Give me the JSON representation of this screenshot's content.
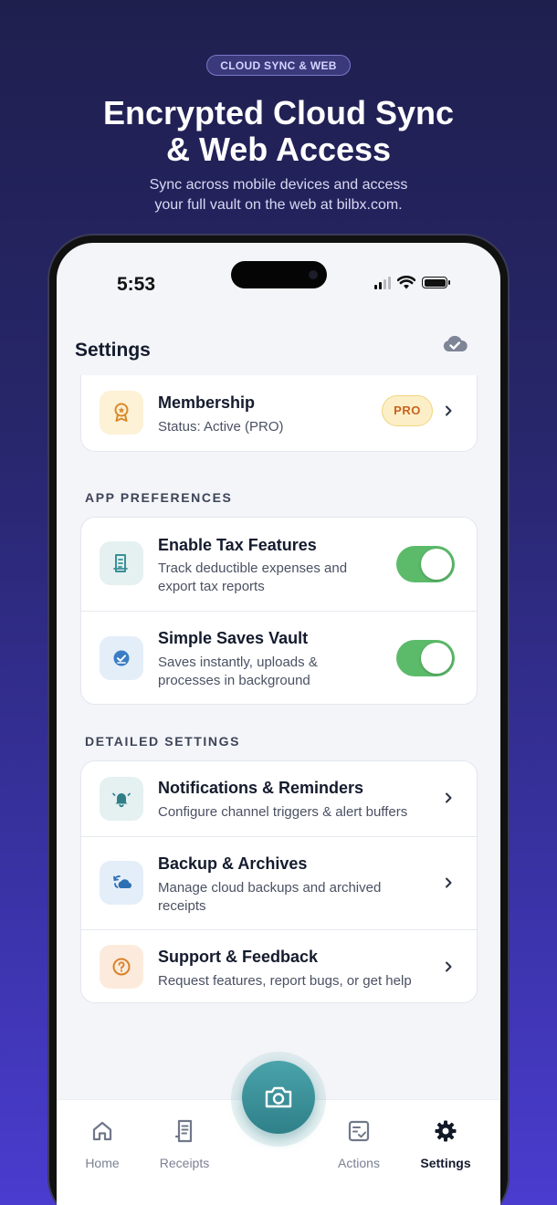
{
  "hero": {
    "badge": "CLOUD SYNC & WEB",
    "title_line1": "Encrypted Cloud Sync",
    "title_line2": "& Web Access",
    "subtitle_line1": "Sync across mobile devices and access",
    "subtitle_line2": "your full vault on the web at bilbx.com."
  },
  "status_bar": {
    "time": "5:53"
  },
  "header": {
    "title": "Settings",
    "cloud_icon": "cloud-check-icon"
  },
  "membership": {
    "title": "Membership",
    "status": "Status: Active (PRO)",
    "badge": "PRO",
    "icon": "award-ribbon-icon"
  },
  "app_preferences": {
    "label": "APP PREFERENCES",
    "items": [
      {
        "title": "Enable Tax Features",
        "sub_line1": "Track deductible expenses and",
        "sub_line2": "export tax reports",
        "enabled": true,
        "icon": "receipt-doc-icon"
      },
      {
        "title": "Simple Saves Vault",
        "sub_line1": "Saves instantly, uploads &",
        "sub_line2": "processes in background",
        "enabled": true,
        "icon": "check-circle-icon"
      }
    ]
  },
  "detailed_settings": {
    "label": "DETAILED SETTINGS",
    "items": [
      {
        "title": "Notifications & Reminders",
        "sub_line1": "Configure channel triggers & alert buffers",
        "sub_line2": "",
        "icon": "bell-icon"
      },
      {
        "title": "Backup & Archives",
        "sub_line1": "Manage cloud backups and archived",
        "sub_line2": "receipts",
        "icon": "cloud-sync-icon"
      },
      {
        "title": "Support & Feedback",
        "sub_line1": "Request features, report bugs, or get help",
        "sub_line2": "",
        "icon": "help-circle-icon"
      }
    ]
  },
  "tabbar": {
    "tabs": [
      {
        "label": "Home",
        "icon": "home-icon",
        "active": false
      },
      {
        "label": "Receipts",
        "icon": "receipt-icon",
        "active": false
      },
      {
        "label": "Actions",
        "icon": "checklist-icon",
        "active": false
      },
      {
        "label": "Settings",
        "icon": "gear-icon",
        "active": true
      }
    ],
    "camera_icon": "camera-icon"
  },
  "colors": {
    "toggle_on": "#5cbb6a",
    "accent_teal": "#3a8f98",
    "pro_badge_text": "#c8621d",
    "background_gradient_top": "#1f1f4e",
    "background_gradient_bottom": "#4a3ccf"
  }
}
